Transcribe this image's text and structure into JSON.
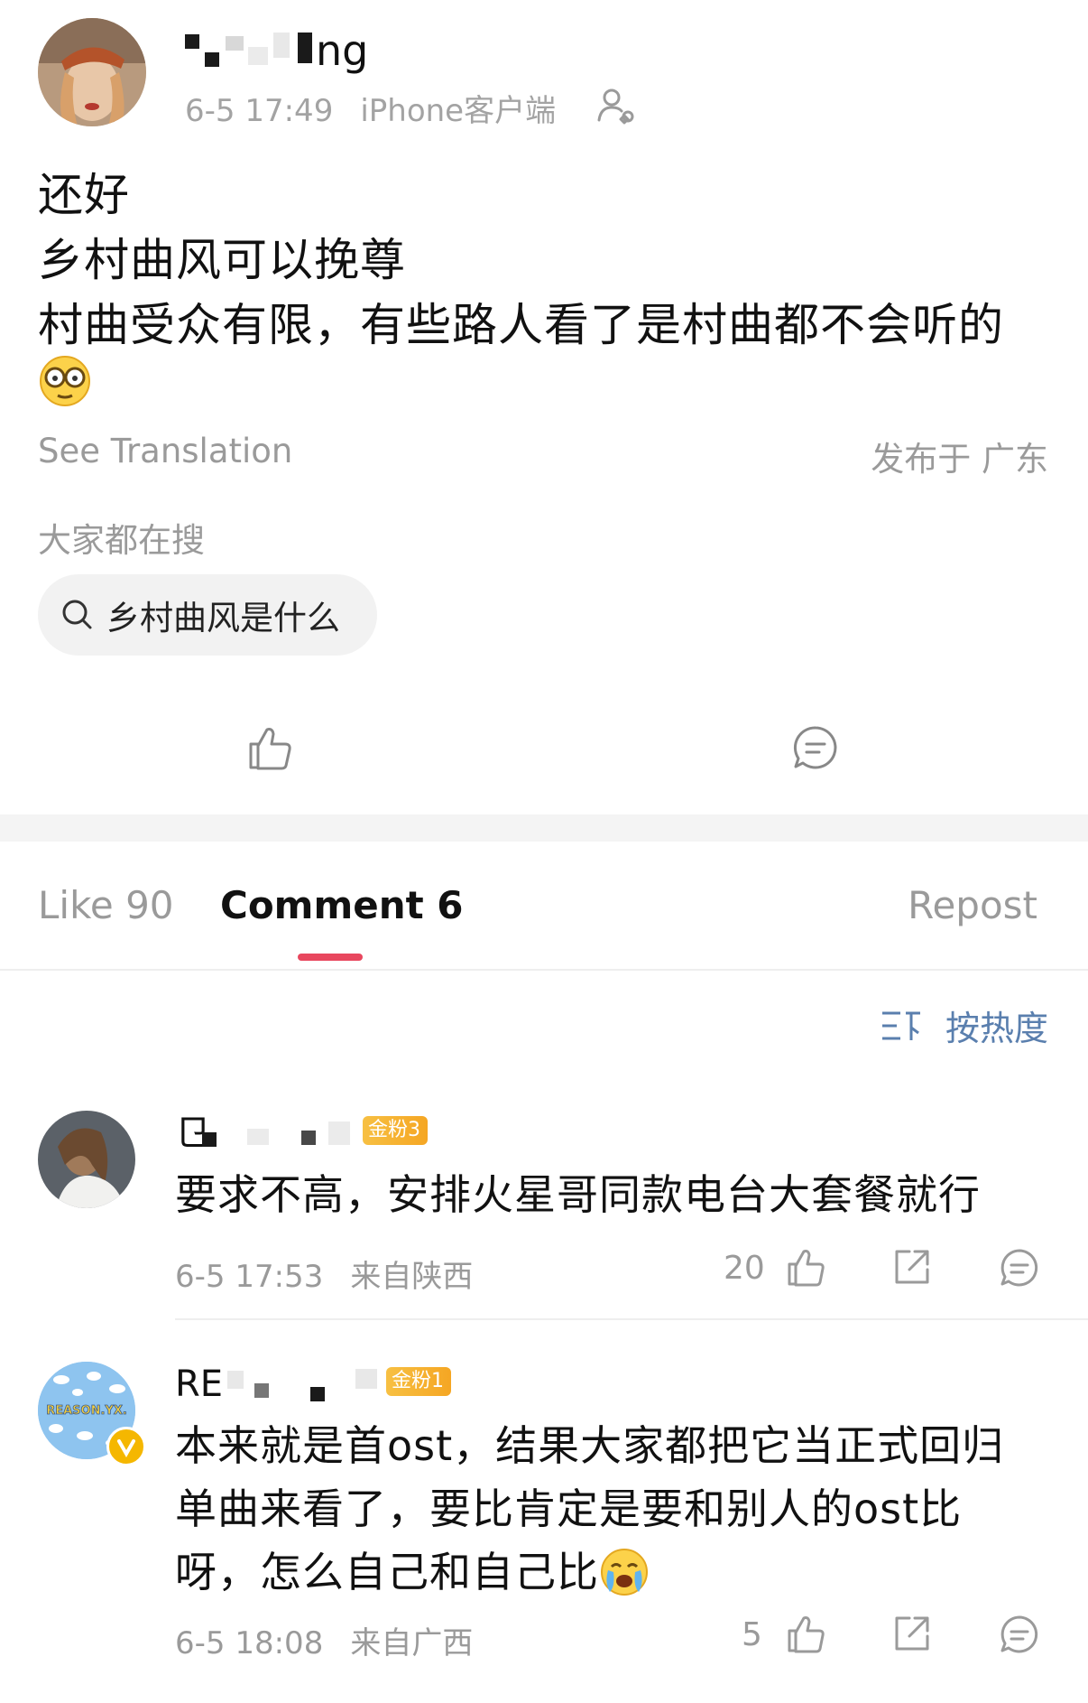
{
  "post": {
    "username_visible": "ng",
    "time": "6-5 17:49",
    "client": "iPhone客户端",
    "lines": [
      "还好",
      "乡村曲风可以挽尊",
      "村曲受众有限，有些路人看了是村曲都不会听的"
    ],
    "see_translation": "See Translation",
    "posted_from": "发布于 广东"
  },
  "trending": {
    "label": "大家都在搜",
    "query": "乡村曲风是什么"
  },
  "tabs": {
    "like": "Like 90",
    "comment": "Comment 6",
    "repost": "Repost"
  },
  "sort": {
    "label": "按热度"
  },
  "comments": [
    {
      "name_visible": "",
      "badge": "金粉3",
      "text_lines": [
        "要求不高，安排火星哥同款电台大套餐就行"
      ],
      "time": "6-5 17:53",
      "location": "来自陕西",
      "likes": "20"
    },
    {
      "name_visible": "RE",
      "badge": "金粉1",
      "text_lines": [
        "本来就是首ost，结果大家都把它当正式回归",
        "单曲来看了，要比肯定是要和别人的ost比",
        "呀，怎么自己和自己比"
      ],
      "time": "6-5 18:08",
      "location": "来自广西",
      "likes": "5",
      "avatar_text": "REASON.YX."
    }
  ],
  "colors": {
    "accent": "#e8475e",
    "sort_blue": "#5a7fae",
    "badge_gold": "#f5a623",
    "muted": "#9a9a9a"
  },
  "icons": [
    "follow-icon",
    "glasses-emoji",
    "search-icon",
    "thumbs-up-icon",
    "comment-icon",
    "sort-icon",
    "share-icon",
    "crying-emoji",
    "verified-icon"
  ]
}
